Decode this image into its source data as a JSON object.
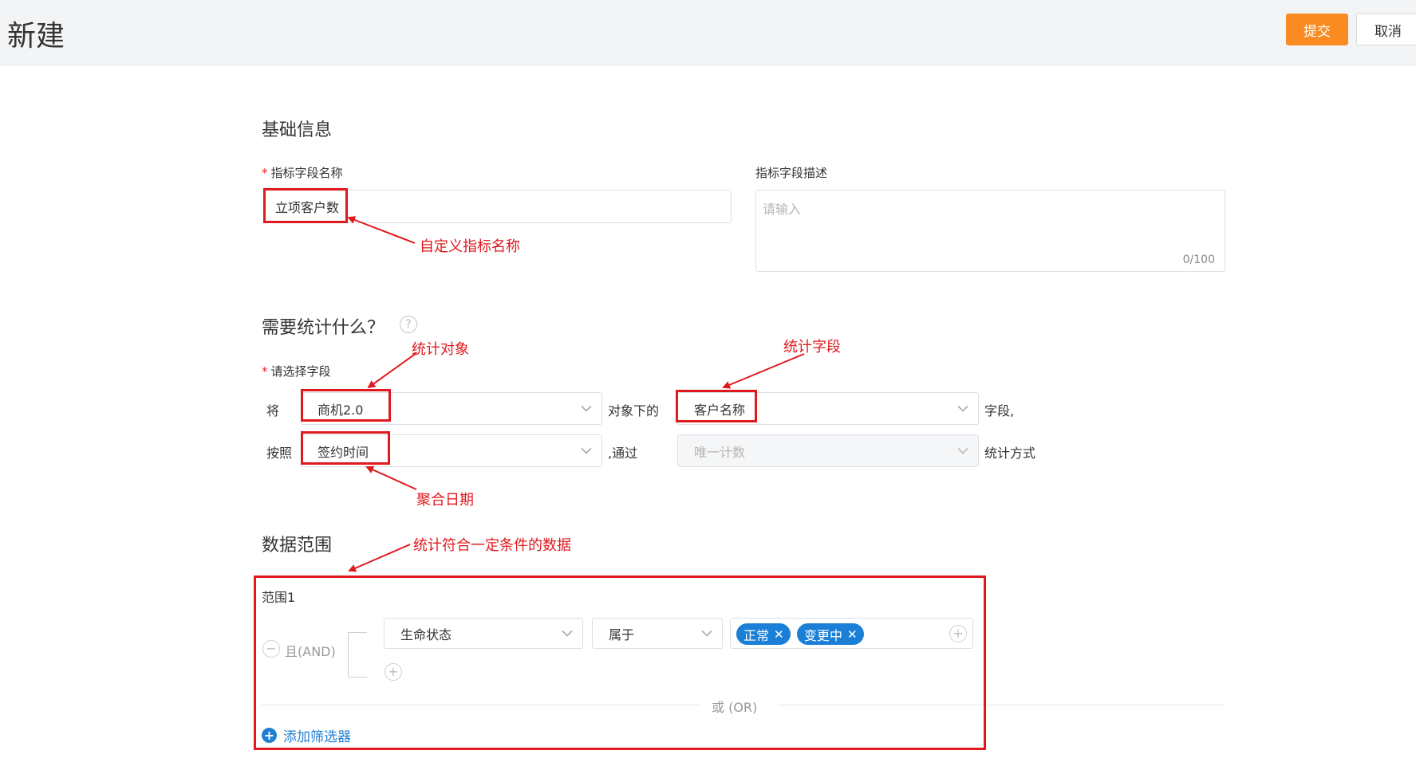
{
  "header": {
    "title": "新建",
    "submit_label": "提交",
    "cancel_label": "取消",
    "submit_color": "#f98b21"
  },
  "basic": {
    "section_title": "基础信息",
    "name_label": "指标字段名称",
    "name_value": "立项客户数",
    "desc_label": "指标字段描述",
    "desc_placeholder": "请输入",
    "desc_counter": "0/100"
  },
  "stats": {
    "section_title": "需要统计什么？",
    "help_icon": "question-circle-icon",
    "field_label": "请选择字段",
    "prefix_jiang": "将",
    "object_value": "商机2.0",
    "object_suffix": "对象下的",
    "field_value": "客户名称",
    "field_suffix": "字段,",
    "prefix_anzhao": "按照",
    "date_value": "签约时间",
    "via_text": ",通过",
    "method_value": "唯一计数",
    "method_suffix": "统计方式"
  },
  "range": {
    "section_title": "数据范围",
    "group_title": "范围1",
    "and_label": "且(AND)",
    "condition_field": "生命状态",
    "condition_op": "属于",
    "tags": [
      "正常",
      "变更中"
    ],
    "or_label": "或  (OR)",
    "add_filter_label": "添加筛选器",
    "tag_color": "#1b7fd7"
  },
  "annotations": {
    "custom_name": "自定义指标名称",
    "stat_object": "统计对象",
    "stat_field": "统计字段",
    "aggregate_date": "聚合日期",
    "range_note": "统计符合一定条件的数据",
    "color": "#e0191f"
  }
}
